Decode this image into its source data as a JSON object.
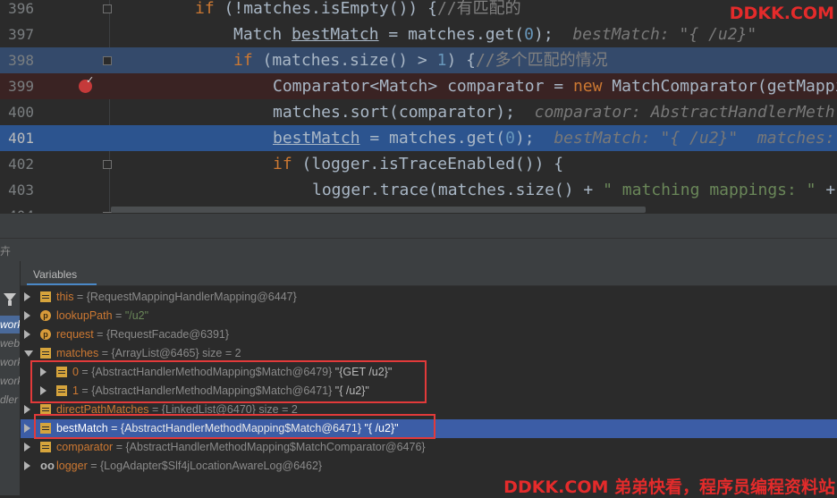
{
  "editor": {
    "lines": [
      {
        "num": "396",
        "parts": [
          [
            "kw",
            "if"
          ],
          [
            "fn",
            " (!matches.isEmpty()) {"
          ],
          [
            "cm",
            "//有匹配的"
          ]
        ]
      },
      {
        "num": "397",
        "parts": [
          [
            "fn",
            "Match "
          ],
          [
            "ul",
            "bestMatch"
          ],
          [
            "fn",
            " = matches.get("
          ],
          [
            "num",
            "0"
          ],
          [
            "fn",
            ");"
          ],
          [
            "hint",
            "  bestMatch: \"{ /u2}\""
          ]
        ]
      },
      {
        "num": "398",
        "parts": [
          [
            "kw",
            "if"
          ],
          [
            "fn",
            " (matches.size() > "
          ],
          [
            "num",
            "1"
          ],
          [
            "fn",
            ") {"
          ],
          [
            "cm",
            "//多个匹配的情况"
          ]
        ]
      },
      {
        "num": "399",
        "parts": [
          [
            "fn",
            "Comparator<Match> comparator = "
          ],
          [
            "kw",
            "new"
          ],
          [
            "fn",
            " MatchComparator(getMappi"
          ]
        ]
      },
      {
        "num": "400",
        "parts": [
          [
            "fn",
            "matches.sort(comparator);"
          ],
          [
            "hint",
            "  comparator: AbstractHandlerMeth"
          ]
        ]
      },
      {
        "num": "401",
        "parts": [
          [
            "ul",
            "bestMatch"
          ],
          [
            "fn",
            " = matches.get("
          ],
          [
            "num",
            "0"
          ],
          [
            "fn",
            ");"
          ],
          [
            "hint",
            "  bestMatch: \"{ /u2}\"  matches:"
          ]
        ]
      },
      {
        "num": "402",
        "parts": [
          [
            "kw",
            "if"
          ],
          [
            "fn",
            " (logger.isTraceEnabled()) {"
          ]
        ]
      },
      {
        "num": "403",
        "parts": [
          [
            "fn",
            "logger.trace(matches.size() + "
          ],
          [
            "str",
            "\" matching mappings: \""
          ],
          [
            "fn",
            " +"
          ]
        ]
      },
      {
        "num": "404",
        "parts": [
          [
            "fn",
            "}"
          ]
        ]
      }
    ]
  },
  "watermark_top": "DDKK.COM",
  "watermark_bottom": "DDKK.COM 弟弟快看，程序员编程资料站",
  "debug": {
    "header_glyph": "卉",
    "variables_tab": "Variables",
    "frames": [
      "work",
      "web",
      "work",
      "work.",
      "dler"
    ]
  },
  "variables": [
    {
      "name": "this",
      "rest": " = {RequestMappingHandlerMapping@6447}",
      "icon": "field",
      "expand": "right"
    },
    {
      "name": "lookupPath",
      "rest": " = ",
      "str": "\"/u2\"",
      "icon": "param",
      "icon_letter": "p",
      "expand": "right"
    },
    {
      "name": "request",
      "rest": " = {RequestFacade@6391}",
      "icon": "param",
      "icon_letter": "p",
      "expand": "right"
    },
    {
      "name": "matches",
      "rest": " = {ArrayList@6465}  size = 2",
      "icon": "field",
      "expand": "down"
    },
    {
      "name": "0",
      "rest": " = {AbstractHandlerMethodMapping$Match@6479} ",
      "white": "\"{GET /u2}\"",
      "icon": "field",
      "expand": "right",
      "child": true
    },
    {
      "name": "1",
      "rest": " = {AbstractHandlerMethodMapping$Match@6471} ",
      "white": "\"{ /u2}\"",
      "icon": "field",
      "expand": "right",
      "child": true
    },
    {
      "name": "directPathMatches",
      "rest": " = {LinkedList@6470}  size = 2",
      "icon": "field",
      "expand": "right"
    },
    {
      "name": "bestMatch",
      "rest": " = {AbstractHandlerMethodMapping$Match@6471} ",
      "white": "\"{ /u2}\"",
      "icon": "field",
      "expand": "right",
      "selected": true
    },
    {
      "name": "comparator",
      "rest": " = {AbstractHandlerMethodMapping$MatchComparator@6476}",
      "icon": "field",
      "expand": "right"
    },
    {
      "name": "logger",
      "rest": " = {LogAdapter$Slf4jLocationAwareLog@6462}",
      "icon": "watch",
      "icon_letter": "oo",
      "expand": "right"
    }
  ]
}
